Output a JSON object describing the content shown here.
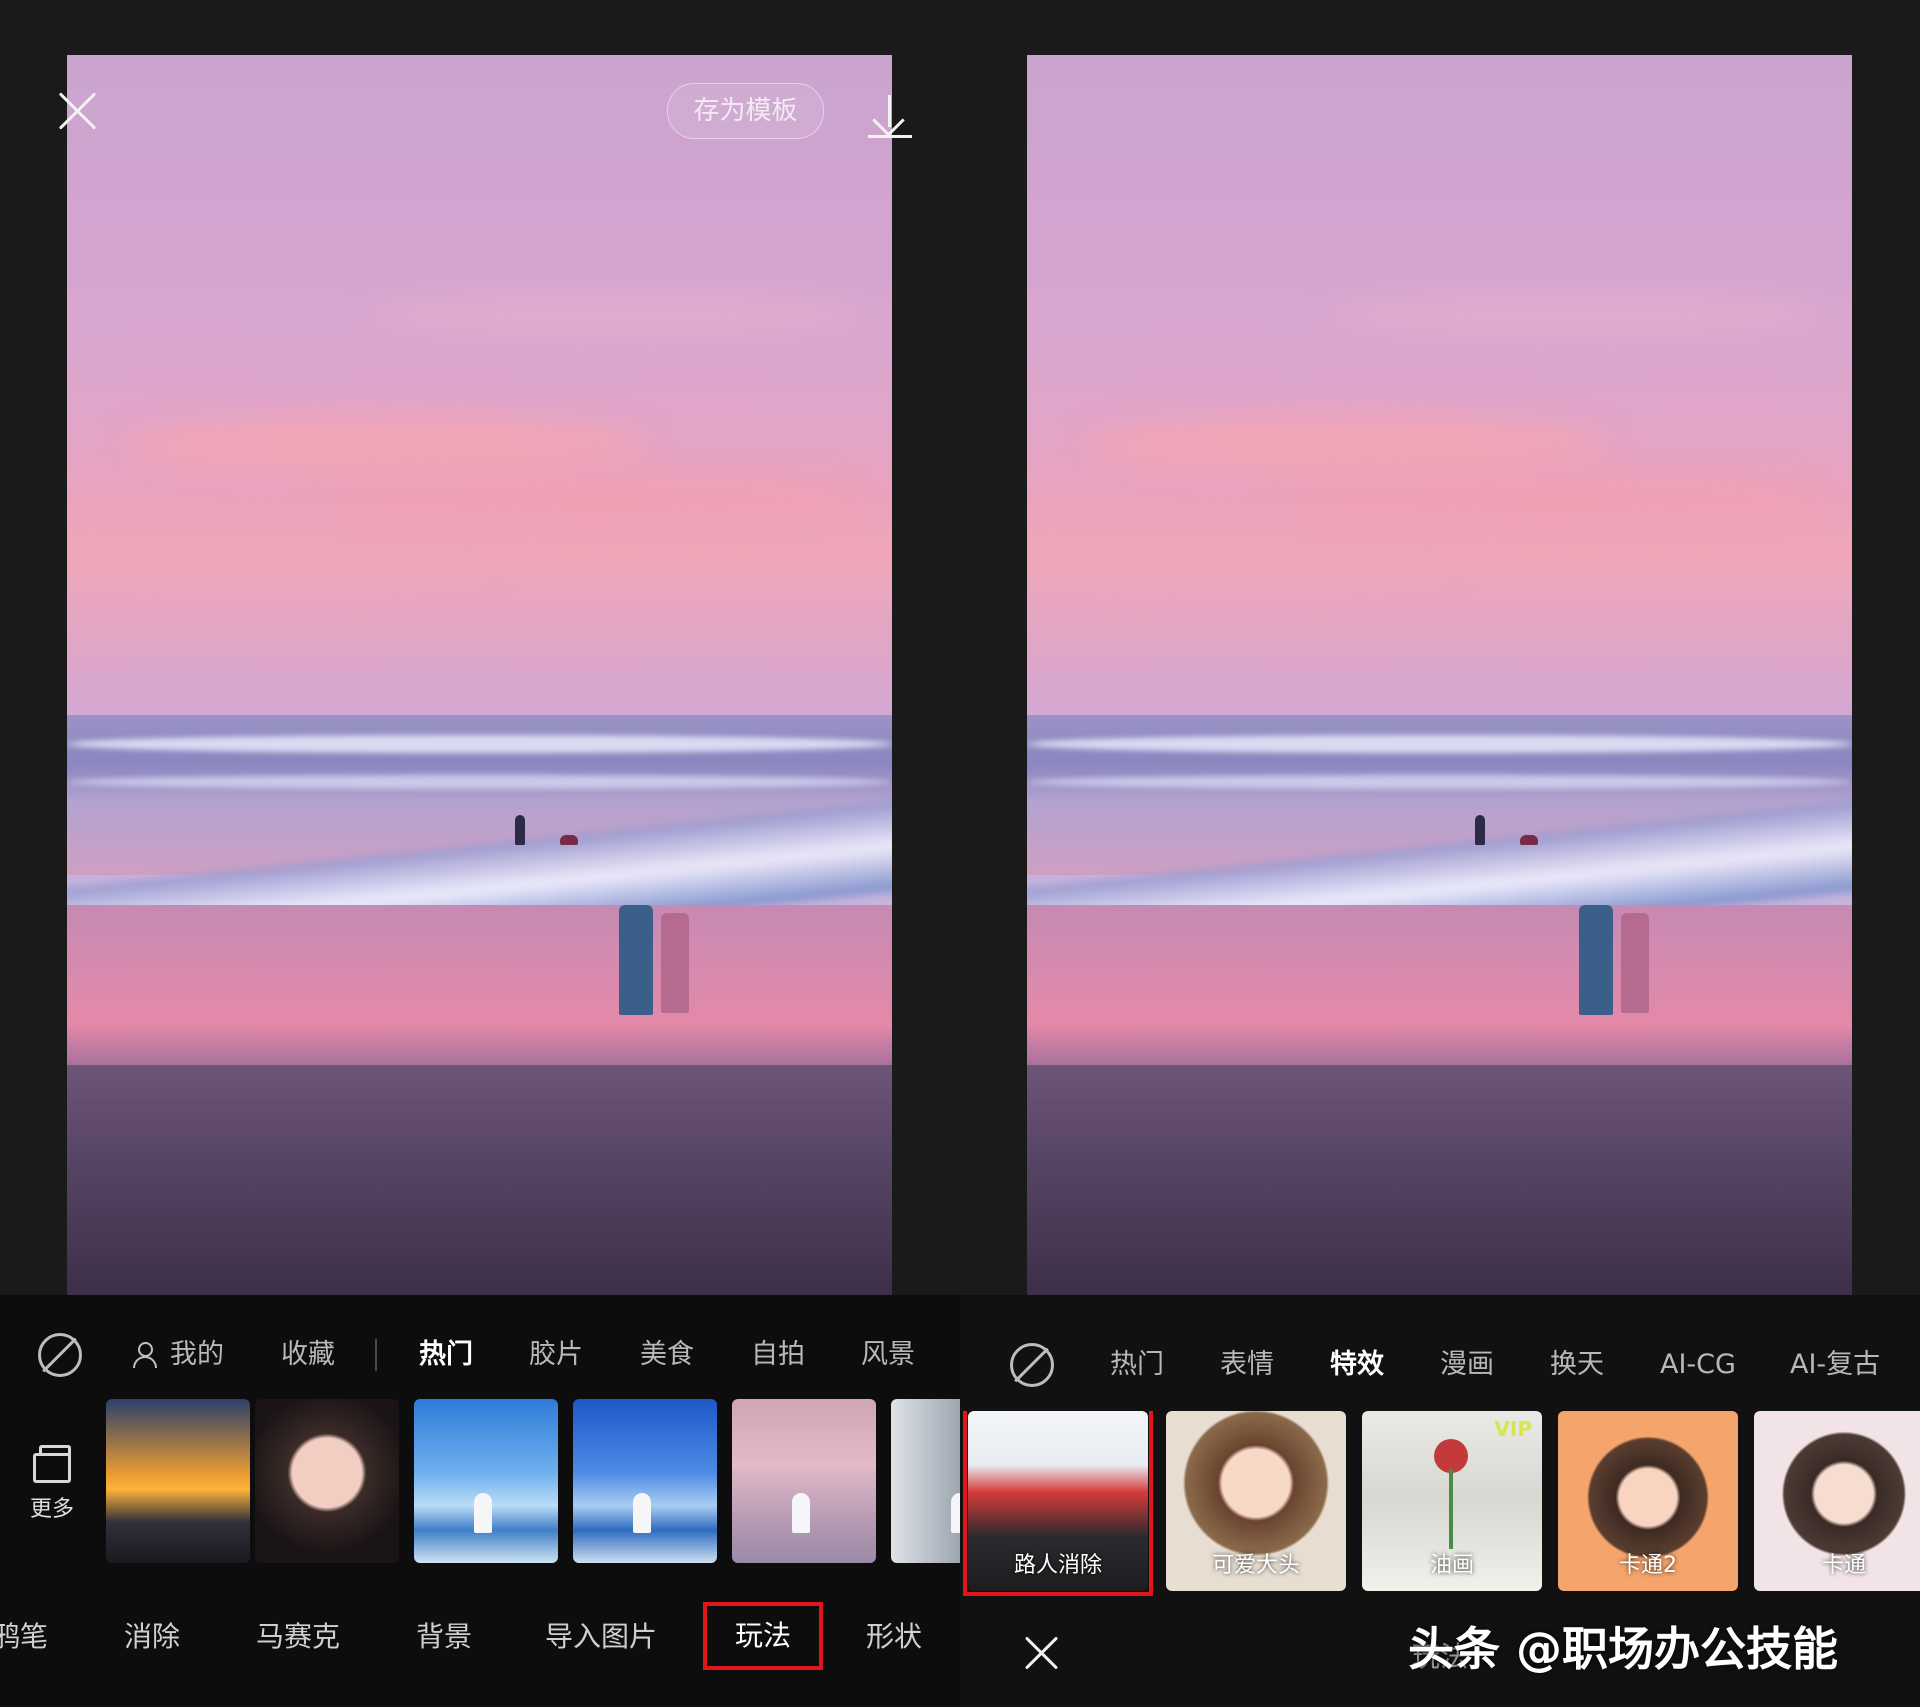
{
  "left": {
    "header": {
      "save_template_label": "存为模板"
    },
    "category_tabs": [
      "我的",
      "收藏",
      "热门",
      "胶片",
      "美食",
      "自拍",
      "风景"
    ],
    "active_category": "热门",
    "more_label": "更多",
    "tools": [
      "鸦笔",
      "消除",
      "马赛克",
      "背景",
      "导入图片",
      "玩法",
      "形状"
    ],
    "selected_tool": "玩法"
  },
  "right": {
    "category_tabs": [
      "热门",
      "表情",
      "特效",
      "漫画",
      "换天",
      "AI-CG",
      "AI-复古"
    ],
    "active_category": "特效",
    "effects": [
      {
        "label": "路人消除",
        "selected": true
      },
      {
        "label": "可爱大头",
        "selected": false
      },
      {
        "label": "油画",
        "selected": false,
        "badge": "VIP"
      },
      {
        "label": "卡通2",
        "selected": false
      },
      {
        "label": "卡通",
        "selected": false
      }
    ],
    "mode_label": "玩法",
    "watermark": "头条 @职场办公技能"
  },
  "colors": {
    "highlight": "#e0161b",
    "background": "#1a1a1b",
    "active_tab": "#ffffff",
    "inactive_tab": "#b8b8b8"
  },
  "icons": [
    "close-icon",
    "download-icon",
    "no-filter-icon",
    "user-icon",
    "more-layers-icon"
  ]
}
